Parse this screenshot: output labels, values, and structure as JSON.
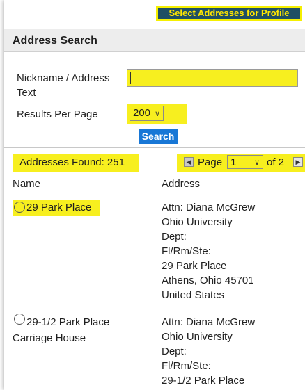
{
  "header": {
    "profile_button": "Select Addresses for Profile"
  },
  "search": {
    "title": "Address Search",
    "nickname_label_line1": "Nickname / Address",
    "nickname_label_line2": "Text",
    "nickname_value": "",
    "rpp_label": "Results Per Page",
    "rpp_value": "200",
    "search_button": "Search"
  },
  "results": {
    "found": "Addresses Found: 251",
    "pager": {
      "word": "Page",
      "current": "1",
      "of": "of 2"
    },
    "columns": {
      "name": "Name",
      "address": "Address"
    },
    "rows": [
      {
        "name_line1": "29 Park Place",
        "name_line2": "",
        "address": [
          "Attn: Diana McGrew",
          "Ohio University",
          "Dept:",
          "Fl/Rm/Ste:",
          "29 Park Place",
          "Athens, Ohio 45701",
          "United States"
        ]
      },
      {
        "name_line1": "29-1/2 Park Place",
        "name_line2": "Carriage House",
        "address": [
          "Attn: Diana McGrew",
          "Ohio University",
          "Dept:",
          "Fl/Rm/Ste:",
          "29-1/2 Park Place"
        ]
      }
    ]
  },
  "colors": {
    "highlight": "#f7ef1f",
    "button_blue": "#1877d6",
    "header_teal": "#1f4f63"
  }
}
